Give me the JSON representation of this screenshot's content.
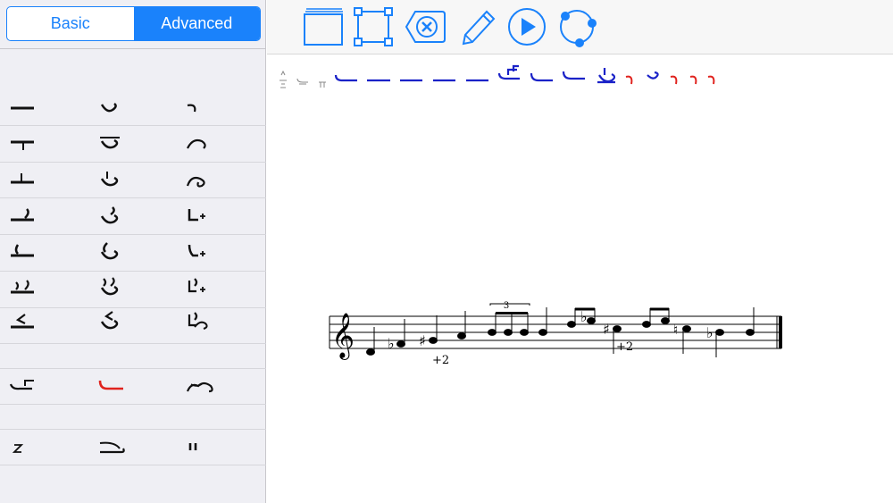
{
  "sidebar": {
    "segments": [
      {
        "label": "Basic",
        "active": false
      },
      {
        "label": "Advanced",
        "active": true
      }
    ]
  },
  "toolbar": {
    "buttons": [
      {
        "name": "layers-icon"
      },
      {
        "name": "selection-frame-icon"
      },
      {
        "name": "delete-backspace-icon"
      },
      {
        "name": "pencil-icon"
      },
      {
        "name": "play-icon"
      },
      {
        "name": "cycle-icon"
      }
    ]
  },
  "score": {
    "tuplet_label": "3",
    "annotations": [
      "+2",
      "+2"
    ]
  },
  "colors": {
    "accent": "#1a82fb",
    "strip_blue": "#1a22c8",
    "strip_red": "#e0231e",
    "selected_red": "#e0231e"
  }
}
